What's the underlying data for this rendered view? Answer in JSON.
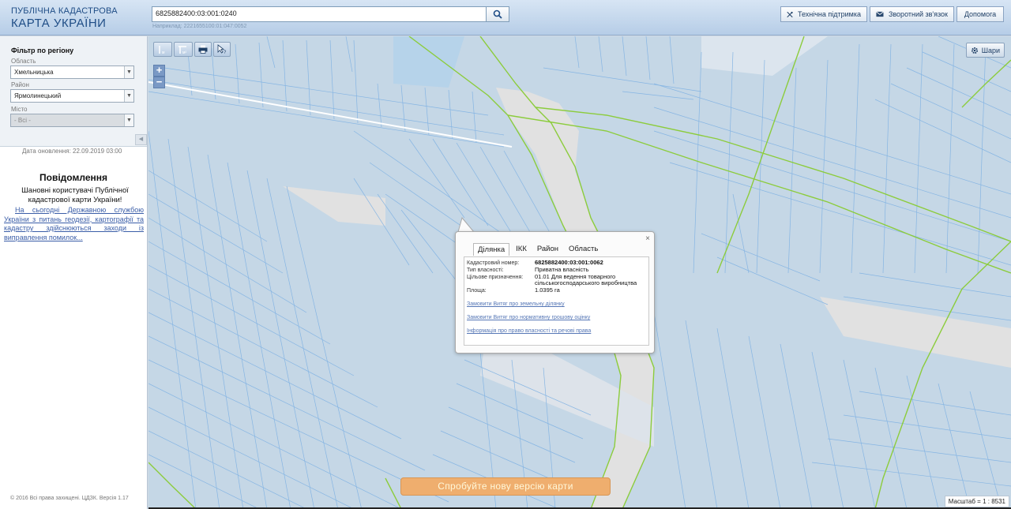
{
  "header": {
    "logo_line1": "ПУБЛІЧНА КАДАСТРОВА",
    "logo_line2": "КАРТА УКРАЇНИ",
    "search_value": "6825882400:03:001:0240",
    "search_hint": "Наприклад: 2221655100:01:047:0052",
    "buttons": {
      "support": "Технічна підтримка",
      "feedback": "Зворотний зв'язок",
      "help": "Допомога"
    }
  },
  "sidebar": {
    "filter_title": "Фільтр по регіону",
    "oblast_label": "Область",
    "oblast_value": "Хмельницька",
    "rayon_label": "Район",
    "rayon_value": "Ярмолинецький",
    "misto_label": "Місто",
    "misto_value": "- Всі -",
    "update_date": "Дата оновлення: 22.09.2019 03:00",
    "notice_title": "Повідомлення",
    "notice_greeting": "Шановні користувачі Публічної кадастрової карти України!",
    "notice_link": "На сьогодні Державною службою України з питань геодезії, картографії та кадастру здійснюються заходи із виправлення помилок...",
    "copyright": "© 2016 Всі права захищені. ЦДЗК. Версія 1.17"
  },
  "map": {
    "layers_label": "Шари",
    "zoom_in": "+",
    "zoom_out": "−",
    "popup": {
      "tabs": [
        "Ділянка",
        "ІКК",
        "Район",
        "Область"
      ],
      "close": "×",
      "fields": [
        {
          "label": "Кадастровий номер:",
          "value": "6825882400:03:001:0062"
        },
        {
          "label": "Тип власності:",
          "value": "Приватна власність"
        },
        {
          "label": "Цільове призначення:",
          "value": "01.01 Для ведення товарного сільськогосподарського виробництва"
        },
        {
          "label": "Площа:",
          "value": "1.0395 га"
        }
      ],
      "links": [
        "Замовити Витяг про земельну ділянку",
        "Замовити Витяг про нормативну грошову оцінку",
        "Інформація про право власності та речові права"
      ]
    },
    "new_version": "Спробуйте нову версію карти",
    "scale": "Масштаб = 1 : 8531"
  },
  "colors": {
    "parcel_fill": "#c5d7e6",
    "parcel_line": "#7fb0e0",
    "road_green": "#8ccc3c",
    "road_fill": "#e4e4e4",
    "accent_button": "#efae6e"
  }
}
